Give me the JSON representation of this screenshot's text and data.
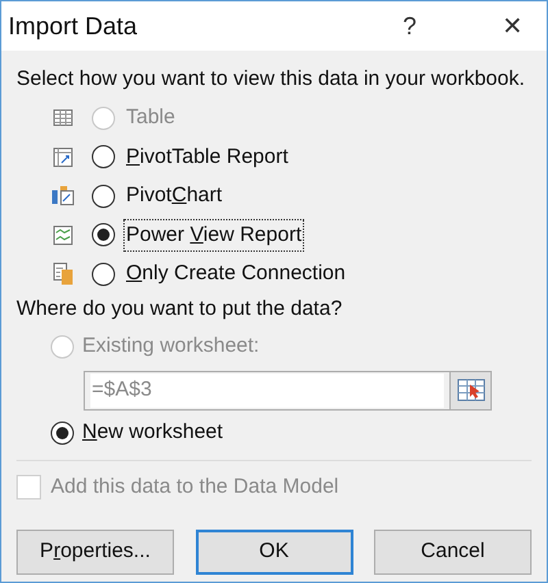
{
  "window": {
    "title": "Import Data",
    "help": "?",
    "close": "✕"
  },
  "view_prompt": "Select how you want to view this data in your workbook.",
  "view_options": [
    {
      "kind": "table",
      "label": [
        {
          "text": "Table",
          "underline": false
        }
      ],
      "selected": false,
      "disabled": true,
      "focused": false
    },
    {
      "kind": "pivottable",
      "label": [
        {
          "text": "P",
          "underline": true
        },
        {
          "text": "ivotTable Report",
          "underline": false
        }
      ],
      "selected": false,
      "disabled": false,
      "focused": false
    },
    {
      "kind": "pivotchart",
      "label": [
        {
          "text": "Pivot",
          "underline": false
        },
        {
          "text": "C",
          "underline": true
        },
        {
          "text": "hart",
          "underline": false
        }
      ],
      "selected": false,
      "disabled": false,
      "focused": false
    },
    {
      "kind": "powerview",
      "label": [
        {
          "text": "Power ",
          "underline": false
        },
        {
          "text": "V",
          "underline": true
        },
        {
          "text": "iew Report",
          "underline": false
        }
      ],
      "selected": true,
      "disabled": false,
      "focused": true
    },
    {
      "kind": "connection",
      "label": [
        {
          "text": "O",
          "underline": true
        },
        {
          "text": "nly Create Connection",
          "underline": false
        }
      ],
      "selected": false,
      "disabled": false,
      "focused": false
    }
  ],
  "place_prompt": "Where do you want to put the data?",
  "place_options": [
    {
      "kind": "existing",
      "label": [
        {
          "text": "Existing worksheet:",
          "underline": false
        }
      ],
      "selected": false,
      "disabled": true,
      "value": "=$A$3"
    },
    {
      "kind": "new",
      "label": [
        {
          "text": "N",
          "underline": true
        },
        {
          "text": "ew worksheet",
          "underline": false
        }
      ],
      "selected": true,
      "disabled": false
    }
  ],
  "data_model": {
    "label": "Add this data to the Data Model",
    "checked": false,
    "disabled": true
  },
  "buttons": [
    {
      "label": [
        {
          "text": "P",
          "underline": false
        },
        {
          "text": "r",
          "underline": true
        },
        {
          "text": "operties...",
          "underline": false
        }
      ],
      "default": false
    },
    {
      "label": [
        {
          "text": "OK",
          "underline": false
        }
      ],
      "default": true
    },
    {
      "label": [
        {
          "text": "Cancel",
          "underline": false
        }
      ],
      "default": false
    }
  ]
}
